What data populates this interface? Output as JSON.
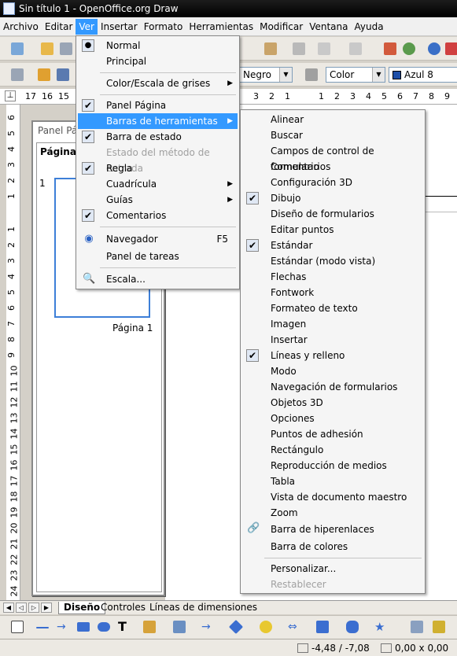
{
  "window": {
    "title": "Sin título 1 - OpenOffice.org Draw"
  },
  "menubar": [
    "Archivo",
    "Editar",
    "Ver",
    "Insertar",
    "Formato",
    "Herramientas",
    "Modificar",
    "Ventana",
    "Ayuda"
  ],
  "toolbar_format": {
    "line_style": "Negro",
    "area_style": "Color",
    "color_name": "Azul 8"
  },
  "hruler": {
    "ticks_left": [
      "17",
      "16",
      "15"
    ],
    "ticks_mid": [
      "3",
      "2",
      "1"
    ],
    "ticks_right": [
      "1",
      "2",
      "3",
      "4",
      "5",
      "6",
      "7",
      "8",
      "9"
    ]
  },
  "vruler": {
    "ticks_top": [
      "6",
      "5",
      "4",
      "3",
      "2",
      "1"
    ],
    "ticks_main": [
      "1",
      "2",
      "3",
      "4",
      "5",
      "6",
      "7",
      "8",
      "9",
      "10",
      "11",
      "12",
      "13",
      "14",
      "15",
      "16",
      "17",
      "18",
      "19",
      "20",
      "21",
      "22",
      "23",
      "24"
    ]
  },
  "pages_panel": {
    "title": "Panel Pág",
    "header": "Páginas",
    "page_number": "1",
    "page_caption": "Página 1"
  },
  "ver_menu": {
    "normal": "Normal",
    "principal": "Principal",
    "color_scale": "Color/Escala de grises",
    "panel_pagina": "Panel Página",
    "toolbars": "Barras de herramientas",
    "statusbar": "Barra de estado",
    "input_method": "Estado del método de entrada",
    "ruler": "Regla",
    "grid": "Cuadrícula",
    "guides": "Guías",
    "comments": "Comentarios",
    "navigator": "Navegador",
    "navigator_shortcut": "F5",
    "task_panel": "Panel de tareas",
    "zoom": "Escala..."
  },
  "toolbars_submenu": [
    {
      "label": "Alinear",
      "checked": false
    },
    {
      "label": "Buscar",
      "checked": false
    },
    {
      "label": "Campos de control de formulario",
      "checked": false
    },
    {
      "label": "Comentarios",
      "checked": false
    },
    {
      "label": "Configuración 3D",
      "checked": false
    },
    {
      "label": "Dibujo",
      "checked": true
    },
    {
      "label": "Diseño de formularios",
      "checked": false
    },
    {
      "label": "Editar puntos",
      "checked": false
    },
    {
      "label": "Estándar",
      "checked": true
    },
    {
      "label": "Estándar (modo vista)",
      "checked": false
    },
    {
      "label": "Flechas",
      "checked": false
    },
    {
      "label": "Fontwork",
      "checked": false
    },
    {
      "label": "Formateo de texto",
      "checked": false
    },
    {
      "label": "Imagen",
      "checked": false
    },
    {
      "label": "Insertar",
      "checked": false
    },
    {
      "label": "Líneas y relleno",
      "checked": true
    },
    {
      "label": "Modo",
      "checked": false
    },
    {
      "label": "Navegación de formularios",
      "checked": false
    },
    {
      "label": "Objetos 3D",
      "checked": false
    },
    {
      "label": "Opciones",
      "checked": false
    },
    {
      "label": "Puntos de adhesión",
      "checked": false
    },
    {
      "label": "Rectángulo",
      "checked": false
    },
    {
      "label": "Reproducción de medios",
      "checked": false
    },
    {
      "label": "Tabla",
      "checked": false
    },
    {
      "label": "Vista de documento maestro",
      "checked": false
    },
    {
      "label": "Zoom",
      "checked": false
    }
  ],
  "toolbars_submenu_extra": {
    "hyperlink": "Barra de hiperenlaces",
    "colors": "Barra de colores",
    "customize": "Personalizar...",
    "reset": "Restablecer"
  },
  "tabs": {
    "diseno": "Diseño",
    "controles": "Controles",
    "dimensiones": "Líneas de dimensiones"
  },
  "status": {
    "position": "-4,48 / -7,08",
    "size": "0,00 x 0,00"
  },
  "colors": {
    "highlight": "#3399ff",
    "titlebar": "#000000"
  }
}
